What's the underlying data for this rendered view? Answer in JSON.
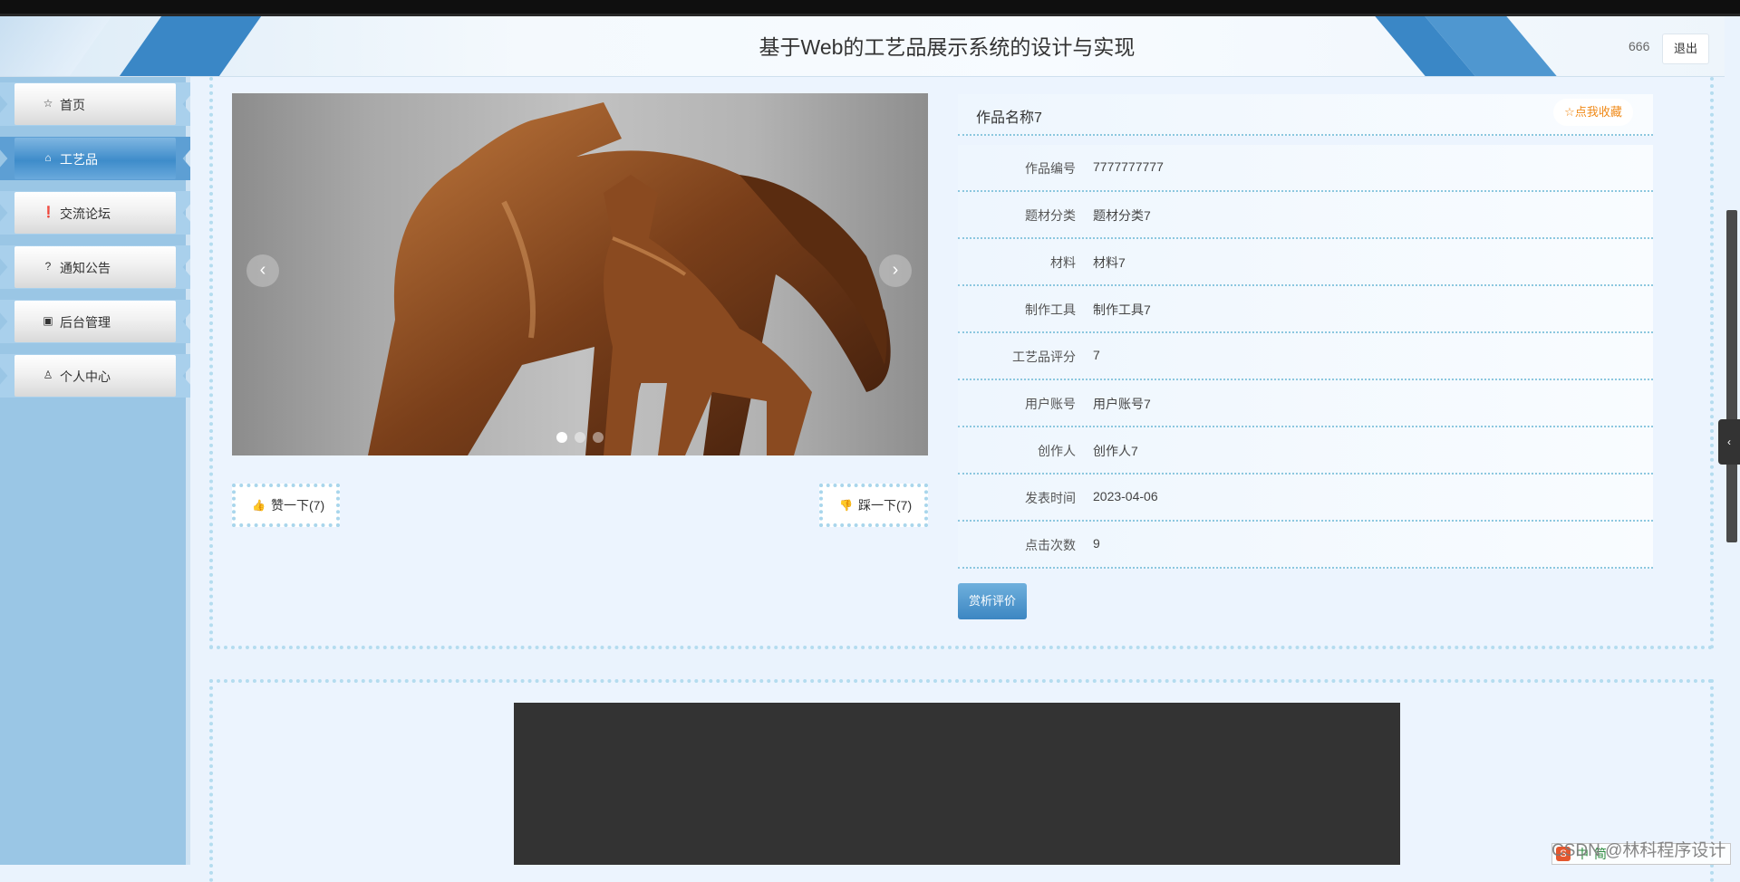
{
  "header": {
    "title": "基于Web的工艺品展示系统的设计与实现",
    "username": "666",
    "logout_label": "退出"
  },
  "sidebar": {
    "items": [
      {
        "label": "首页",
        "icon": "star-icon",
        "glyph": "☆"
      },
      {
        "label": "工艺品",
        "icon": "bag-icon",
        "glyph": "⌂"
      },
      {
        "label": "交流论坛",
        "icon": "alert-icon",
        "glyph": "❗"
      },
      {
        "label": "通知公告",
        "icon": "help-icon",
        "glyph": "?"
      },
      {
        "label": "后台管理",
        "icon": "briefcase-icon",
        "glyph": "▣"
      },
      {
        "label": "个人中心",
        "icon": "user-icon",
        "glyph": "♙"
      }
    ],
    "active_index": 1
  },
  "carousel": {
    "prev_glyph": "‹",
    "next_glyph": "›",
    "slide_count": 3,
    "active_slide": 0
  },
  "votes": {
    "like_label": "赞一下(7)",
    "like_glyph": "👍",
    "dislike_label": "踩一下(7)",
    "dislike_glyph": "👎"
  },
  "detail": {
    "work_name": "作品名称7",
    "favorite_label": "☆点我收藏",
    "rows": [
      {
        "key": "作品编号",
        "value": "7777777777"
      },
      {
        "key": "题材分类",
        "value": "题材分类7"
      },
      {
        "key": "材料",
        "value": "材料7"
      },
      {
        "key": "制作工具",
        "value": "制作工具7"
      },
      {
        "key": "工艺品评分",
        "value": "7"
      },
      {
        "key": "用户账号",
        "value": "用户账号7"
      },
      {
        "key": "创作人",
        "value": "创作人7"
      },
      {
        "key": "发表时间",
        "value": "2023-04-06"
      },
      {
        "key": "点击次数",
        "value": "9"
      }
    ],
    "review_button": "赏析评价"
  },
  "watermark": "CSDN @林科程序设计",
  "ime": {
    "logo": "S",
    "items": [
      "中",
      "简"
    ]
  },
  "side_toggle_glyph": "‹",
  "colors": {
    "accent": "#3a87c6",
    "favorite": "#f08a18",
    "sidebar": "#9ac6e5"
  }
}
